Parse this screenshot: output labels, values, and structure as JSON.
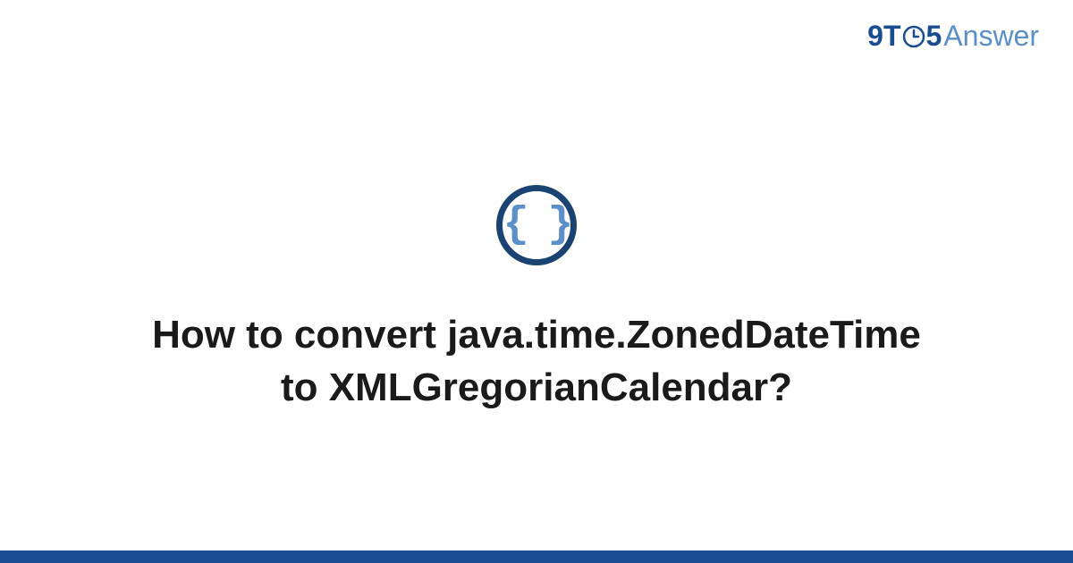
{
  "logo": {
    "part1": "9T",
    "part3": "5",
    "part4": "Answer"
  },
  "icon": {
    "braces": "{ }"
  },
  "title": "How to convert java.time.ZonedDateTime to XMLGregorianCalendar?",
  "colors": {
    "darkBlue": "#1a4d8f",
    "lightBlue": "#5a8fc7",
    "circleBorder": "#1a4373"
  }
}
